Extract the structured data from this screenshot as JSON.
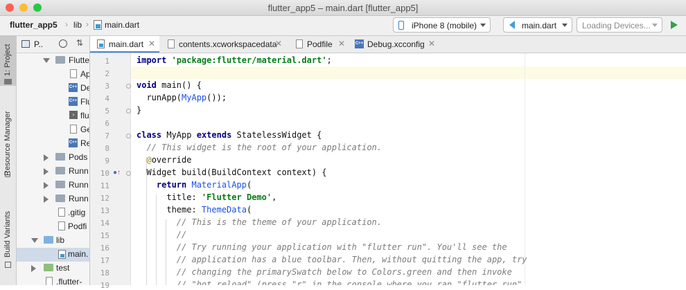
{
  "window": {
    "title": "flutter_app5 – main.dart [flutter_app5]"
  },
  "breadcrumb": {
    "project": "flutter_app5",
    "folder": "lib",
    "file": "main.dart"
  },
  "toolbar": {
    "device": "iPhone 8 (mobile)",
    "config": "main.dart",
    "devices_placeholder": "Loading Devices...",
    "run_icon": "play-icon"
  },
  "tool_strip": {
    "project": "1: Project",
    "resource": "Resource Manager",
    "variants": "Build Variants"
  },
  "project_panel": {
    "view": "P..",
    "rows": [
      {
        "label": "Flutte",
        "kind": "folder-open"
      },
      {
        "label": "Ap",
        "kind": "file"
      },
      {
        "label": "De",
        "kind": "cpp"
      },
      {
        "label": "Flu",
        "kind": "cpp"
      },
      {
        "label": "flu",
        "kind": "script"
      },
      {
        "label": "Ge",
        "kind": "file"
      },
      {
        "label": "Re",
        "kind": "cpp"
      },
      {
        "label": "Pods",
        "kind": "folder"
      },
      {
        "label": "Runn",
        "kind": "folder"
      },
      {
        "label": "Runn",
        "kind": "folder"
      },
      {
        "label": "Runn",
        "kind": "folder"
      },
      {
        "label": ".gitig",
        "kind": "file"
      },
      {
        "label": "Podfi",
        "kind": "file"
      },
      {
        "label": "lib",
        "kind": "folder-open"
      },
      {
        "label": "main.",
        "kind": "dart"
      },
      {
        "label": "test",
        "kind": "folder"
      },
      {
        "label": ".flutter-",
        "kind": "file"
      }
    ]
  },
  "tabs": [
    {
      "label": "main.dart",
      "active": true
    },
    {
      "label": "contents.xcworkspacedata",
      "active": false
    },
    {
      "label": "Podfile",
      "active": false
    },
    {
      "label": "Debug.xcconfig",
      "active": false
    }
  ],
  "editor": {
    "lines": [
      "1",
      "2",
      "3",
      "4",
      "5",
      "6",
      "7",
      "8",
      "9",
      "10",
      "11",
      "12",
      "13",
      "14",
      "15",
      "16",
      "17",
      "18",
      "19"
    ],
    "code": [
      "import 'package:flutter/material.dart';",
      "",
      "void main() {",
      "  runApp(MyApp());",
      "}",
      "",
      "class MyApp extends StatelessWidget {",
      "  // This widget is the root of your application.",
      "  @override",
      "  Widget build(BuildContext context) {",
      "    return MaterialApp(",
      "      title: 'Flutter Demo',",
      "      theme: ThemeData(",
      "        // This is the theme of your application.",
      "        //",
      "        // Try running your application with \"flutter run\". You'll see the",
      "        // application has a blue toolbar. Then, without quitting the app, try",
      "        // changing the primarySwatch below to Colors.green and then invoke",
      "        // \"hot reload\" (press \"r\" in the console where you ran \"flutter run\","
    ]
  },
  "colors": {
    "keyword": "#000080",
    "string": "#067d17",
    "comment": "#7c7c7c",
    "type": "#1750eb",
    "accent": "#4a8ad8"
  }
}
